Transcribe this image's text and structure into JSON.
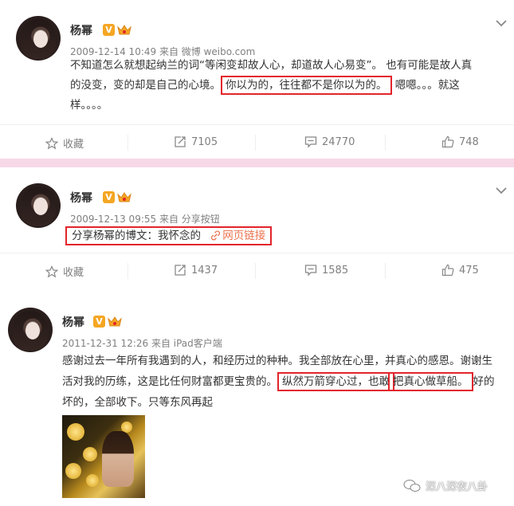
{
  "posts": [
    {
      "name": "杨幂",
      "meta": "2009-12-14 10:49 来自 微博 weibo.com",
      "text_a": "不知道怎么就想起纳兰的词“等闲变却故人心，却道故人心易变”。 也有可能是故人真的没变，变的却是自己的心境。",
      "highlight": "你以为的，往往都不是你以为的。",
      "text_b": " 嗯嗯。。。就这样。。。。",
      "actions": {
        "fav": "收藏",
        "repost": "7105",
        "comment": "24770",
        "like": "748"
      }
    },
    {
      "name": "杨幂",
      "meta": "2009-12-13 09:55 来自 分享按钮",
      "highlight": "分享杨幂的博文：我怀念的",
      "link": "网页链接",
      "actions": {
        "fav": "收藏",
        "repost": "1437",
        "comment": "1585",
        "like": "475"
      }
    },
    {
      "name": "杨幂",
      "meta": "2011-12-31 12:26 来自 iPad客户端",
      "text_a": "感谢过去一年所有我遇到的人，和经历过的种种。我全部放在心里，并真心的感恩。谢谢生活对我的历练，这是比任何财富都更宝贵的。",
      "highlight_1": "纵然万箭穿心过，也敢",
      "highlight_2": "把真心做草船。",
      "text_b": "好的坏的，全部收下。只等东风再起"
    }
  ],
  "watermark": "深八深夜八卦",
  "colors": {
    "highlight_border": "#e3242b",
    "divider": "#f7d8e6",
    "link": "#eb7350",
    "badge": "#f5a623"
  }
}
